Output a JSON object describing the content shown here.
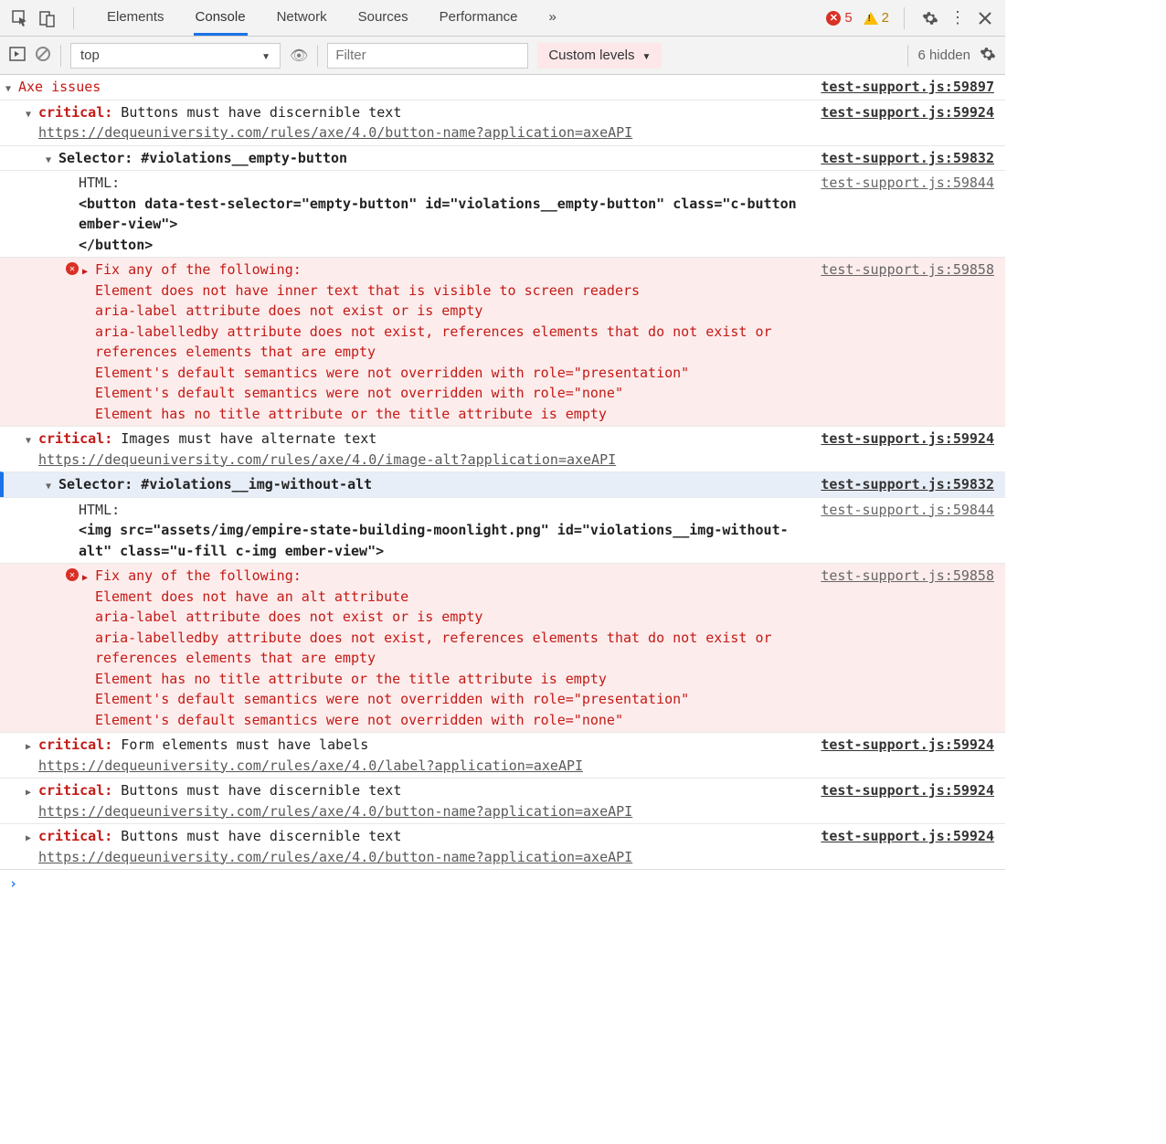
{
  "topbar": {
    "tabs": [
      "Elements",
      "Console",
      "Network",
      "Sources",
      "Performance"
    ],
    "active_tab": "Console",
    "more": "»",
    "errors": "5",
    "warnings": "2"
  },
  "toolbar": {
    "context": "top",
    "filter_placeholder": "Filter",
    "levels": "Custom levels",
    "hidden": "6 hidden"
  },
  "sources": {
    "s59897": "test-support.js:59897",
    "s59924": "test-support.js:59924",
    "s59832": "test-support.js:59832",
    "s59844": "test-support.js:59844",
    "s59858": "test-support.js:59858"
  },
  "group": {
    "title": "Axe issues"
  },
  "issues": [
    {
      "severity": "critical:",
      "msg": " Buttons must have discernible text",
      "url": "https://dequeuniversity.com/rules/axe/4.0/button-name?application=axeAPI",
      "selector_label": "Selector:",
      "selector_val": " #violations__empty-button",
      "html_label": "HTML:",
      "html_code": "<button data-test-selector=\"empty-button\" id=\"violations__empty-button\" class=\"c-button ember-view\">\n</button>",
      "fix_title": "Fix any of the following:",
      "fix_lines": [
        "  Element does not have inner text that is visible to screen readers",
        "  aria-label attribute does not exist or is empty",
        "  aria-labelledby attribute does not exist, references elements that do not exist or references elements that are empty",
        "  Element's default semantics were not overridden with role=\"presentation\"",
        "  Element's default semantics were not overridden with role=\"none\"",
        "  Element has no title attribute or the title attribute is empty"
      ]
    },
    {
      "severity": "critical:",
      "msg": " Images must have alternate text",
      "url": "https://dequeuniversity.com/rules/axe/4.0/image-alt?application=axeAPI",
      "selector_label": "Selector:",
      "selector_val": " #violations__img-without-alt",
      "html_label": "HTML:",
      "html_code": "<img src=\"assets/img/empire-state-building-moonlight.png\" id=\"violations__img-without-alt\" class=\"u-fill c-img ember-view\">",
      "fix_title": "Fix any of the following:",
      "fix_lines": [
        "  Element does not have an alt attribute",
        "  aria-label attribute does not exist or is empty",
        "  aria-labelledby attribute does not exist, references elements that do not exist or references elements that are empty",
        "  Element has no title attribute or the title attribute is empty",
        "  Element's default semantics were not overridden with role=\"presentation\"",
        "  Element's default semantics were not overridden with role=\"none\""
      ]
    },
    {
      "severity": "critical:",
      "msg": " Form elements must have labels",
      "url": "https://dequeuniversity.com/rules/axe/4.0/label?application=axeAPI"
    },
    {
      "severity": "critical:",
      "msg": " Buttons must have discernible text",
      "url": "https://dequeuniversity.com/rules/axe/4.0/button-name?application=axeAPI"
    },
    {
      "severity": "critical:",
      "msg": " Buttons must have discernible text",
      "url": "https://dequeuniversity.com/rules/axe/4.0/button-name?application=axeAPI"
    }
  ]
}
